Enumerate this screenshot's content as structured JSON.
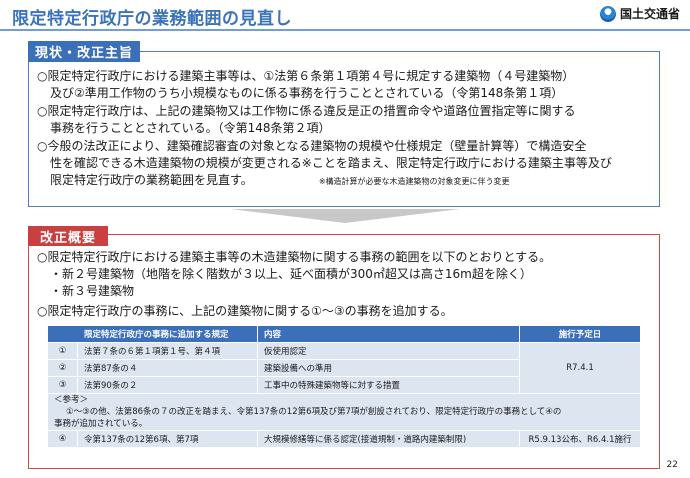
{
  "header": {
    "title": "限定特定行政庁の業務範囲の見直し",
    "logo_text": "国土交通省"
  },
  "section1": {
    "tag": "現状・改正主旨",
    "p1_l1": "○限定特定行政庁における建築主事等は、①法第６条第１項第４号に規定する建築物（４号建築物）",
    "p1_l2": "及び②準用工作物のうち小規模なものに係る事務を行うこととされている（令第148条第１項）",
    "p2_l1": "○限定特定行政庁は、上記の建築物又は工作物に係る違反是正の措置命令や道路位置指定等に関する",
    "p2_l2": "事務を行うこととされている。（令第148条第２項）",
    "p3_l1": "○今般の法改正により、建築確認審査の対象となる建築物の規模や仕様規定（壁量計算等）で構造安全",
    "p3_l2": "性を確認できる木造建築物の規模が変更される※ことを踏まえ、限定特定行政庁における建築主事等及び",
    "p3_l3": "限定特定行政庁の業務範囲を見直す。",
    "p3_note": "※構造計算が必要な木造建築物の対象変更に伴う変更"
  },
  "section2": {
    "tag": "改正概要",
    "p1": "○限定特定行政庁における建築主事等の木造建築物に関する事務の範囲を以下のとおりとする。",
    "b1": "・新２号建築物（地階を除く階数が３以上、延べ面積が300㎡超又は高さ16m超を除く）",
    "b2": "・新３号建築物",
    "p2": "○限定特定行政庁の事務に、上記の建築物に関する①～③の事務を追加する。"
  },
  "table": {
    "headers": [
      "限定特定行政庁の事務に追加する規定",
      "内容",
      "施行予定日"
    ],
    "rows": [
      {
        "num": "①",
        "rule": "法第７条の６第１項第１号、第４項",
        "content": "仮使用認定"
      },
      {
        "num": "②",
        "rule": "法第87条の４",
        "content": "建築設備への準用"
      },
      {
        "num": "③",
        "rule": "法第90条の２",
        "content": "工事中の特殊建築物等に対する措置"
      }
    ],
    "date_123": "R7.4.1",
    "note_head": "＜参考＞",
    "note_l1": "①～③の他、法第86条の７の改正を踏まえ、令第137条の12第6項及び第7項が創設されており、限定特定行政庁の事務として④の",
    "note_l2": "事務が追加されている。",
    "row4": {
      "num": "④",
      "rule": "令第137条の12第6項、第7項",
      "content": "大規模修繕等に係る認定(接道規制・道路内建築制限)",
      "date": "R5.9.13公布、R6.4.1施行"
    }
  },
  "page_number": "22",
  "colors": {
    "blue": "#3b6fb8",
    "red": "#c94040",
    "cell": "#dde5f1"
  }
}
